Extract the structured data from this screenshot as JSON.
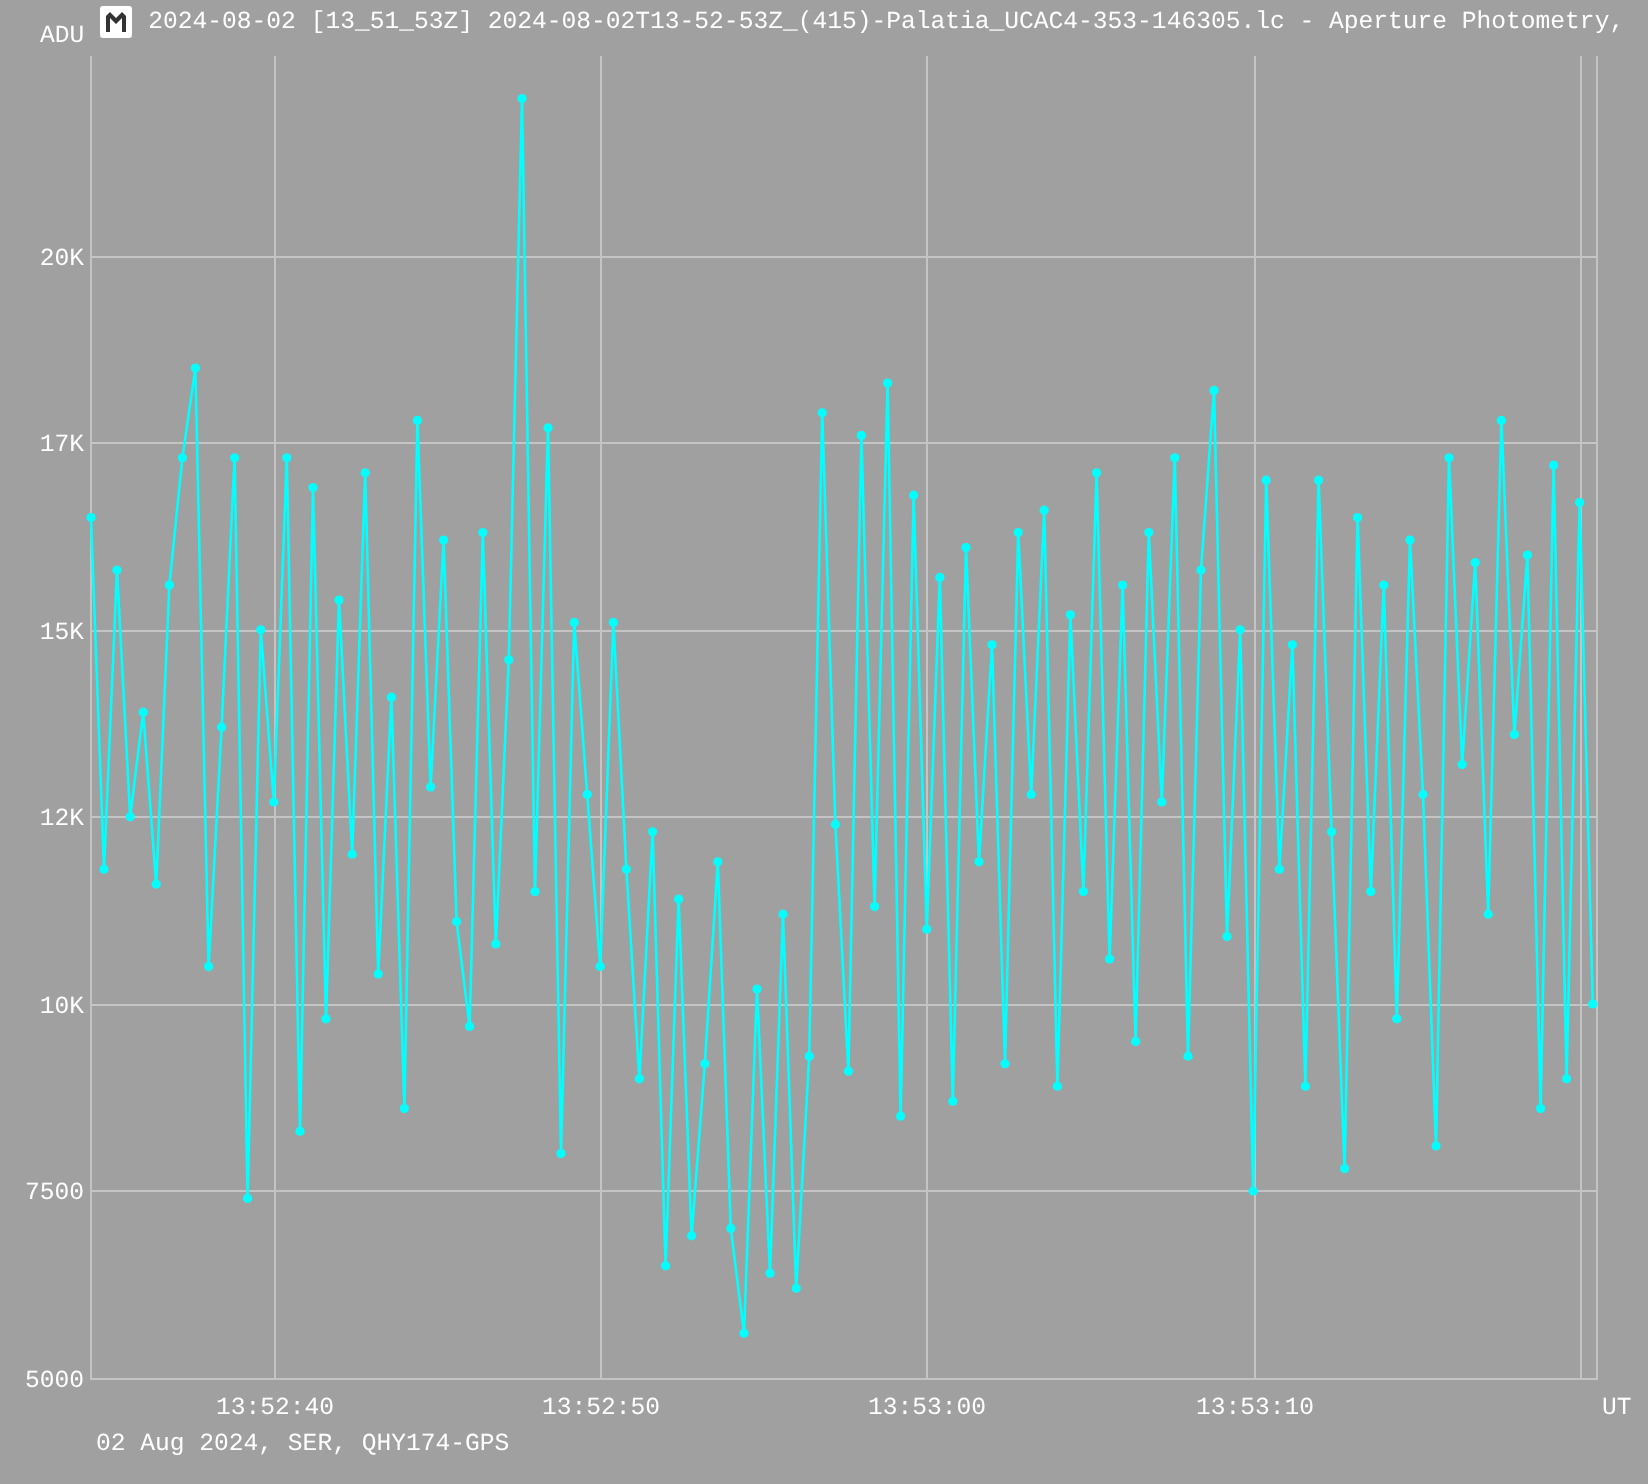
{
  "title": "2024-08-02 [13_51_53Z] 2024-08-02T13-52-53Z_(415)-Palatia_UCAC4-353-146305.lc - Aperture Photometry,",
  "chart": {
    "chart_data": {
      "type": "line",
      "xlabel": "UT",
      "ylabel": "ADU",
      "categories": [
        null,
        null,
        null,
        null,
        null,
        null,
        null,
        null,
        null,
        null,
        null,
        null,
        null,
        null,
        "13:52:40",
        null,
        null,
        null,
        null,
        null,
        null,
        null,
        null,
        null,
        null,
        null,
        null,
        null,
        null,
        null,
        null,
        null,
        null,
        null,
        null,
        null,
        null,
        null,
        null,
        "13:52:50",
        null,
        null,
        null,
        null,
        null,
        null,
        null,
        null,
        null,
        null,
        null,
        null,
        null,
        null,
        null,
        null,
        null,
        null,
        null,
        null,
        null,
        null,
        null,
        null,
        "13:53:00",
        null,
        null,
        null,
        null,
        null,
        null,
        null,
        null,
        null,
        null,
        null,
        null,
        null,
        null,
        null,
        null,
        null,
        null,
        null,
        null,
        null,
        null,
        null,
        null,
        "13:53:10",
        null,
        null,
        null,
        null,
        null,
        null,
        null,
        null,
        null,
        null,
        null,
        null,
        null,
        null,
        null,
        null,
        null,
        null,
        null,
        null,
        null,
        null,
        null,
        null,
        null,
        null
      ],
      "grid": true,
      "series": [
        {
          "color": "#00ffff",
          "marker": "circle",
          "values": [
            16500,
            11800,
            15800,
            12500,
            13900,
            11600,
            15600,
            17300,
            18500,
            10500,
            13700,
            17300,
            7400,
            15000,
            12700,
            17300,
            8300,
            16900,
            9800,
            15400,
            12000,
            17100,
            10400,
            14100,
            8600,
            17800,
            12900,
            16200,
            11100,
            9700,
            16300,
            10800,
            14600,
            22100,
            11500,
            17700,
            8000,
            15100,
            12800,
            10500,
            15100,
            11800,
            9000,
            12300,
            6500,
            11400,
            6900,
            9200,
            11900,
            7000,
            5600,
            10200,
            6400,
            11200,
            6200,
            9300,
            17900,
            12400,
            9100,
            17600,
            11300,
            18300,
            8500,
            16800,
            11000,
            15700,
            8700,
            16100,
            11900,
            14800,
            9200,
            16300,
            12800,
            16600,
            8900,
            15200,
            11500,
            17100,
            10600,
            15600,
            9500,
            16300,
            12700,
            17300,
            9300,
            15800,
            18200,
            10900,
            15000,
            7500,
            17000,
            11800,
            14800,
            8900,
            17000,
            12300,
            7800,
            16500,
            11500,
            15600,
            9800,
            16200,
            12800,
            8100,
            17300,
            13200,
            15900,
            11200,
            17800,
            13600,
            16000,
            8600,
            17200,
            9000,
            16700,
            10000
          ]
        }
      ],
      "ylim": [
        5000,
        22670
      ],
      "yticks": [
        {
          "value": 20000,
          "label": "20K"
        },
        {
          "value": 17500,
          "label": "17K"
        },
        {
          "value": 15000,
          "label": "15K"
        },
        {
          "value": 12500,
          "label": "12K"
        },
        {
          "value": 10000,
          "label": "10K"
        },
        7500,
        5000
      ]
    }
  },
  "footer": "02 Aug 2024, SER, QHY174-GPS"
}
